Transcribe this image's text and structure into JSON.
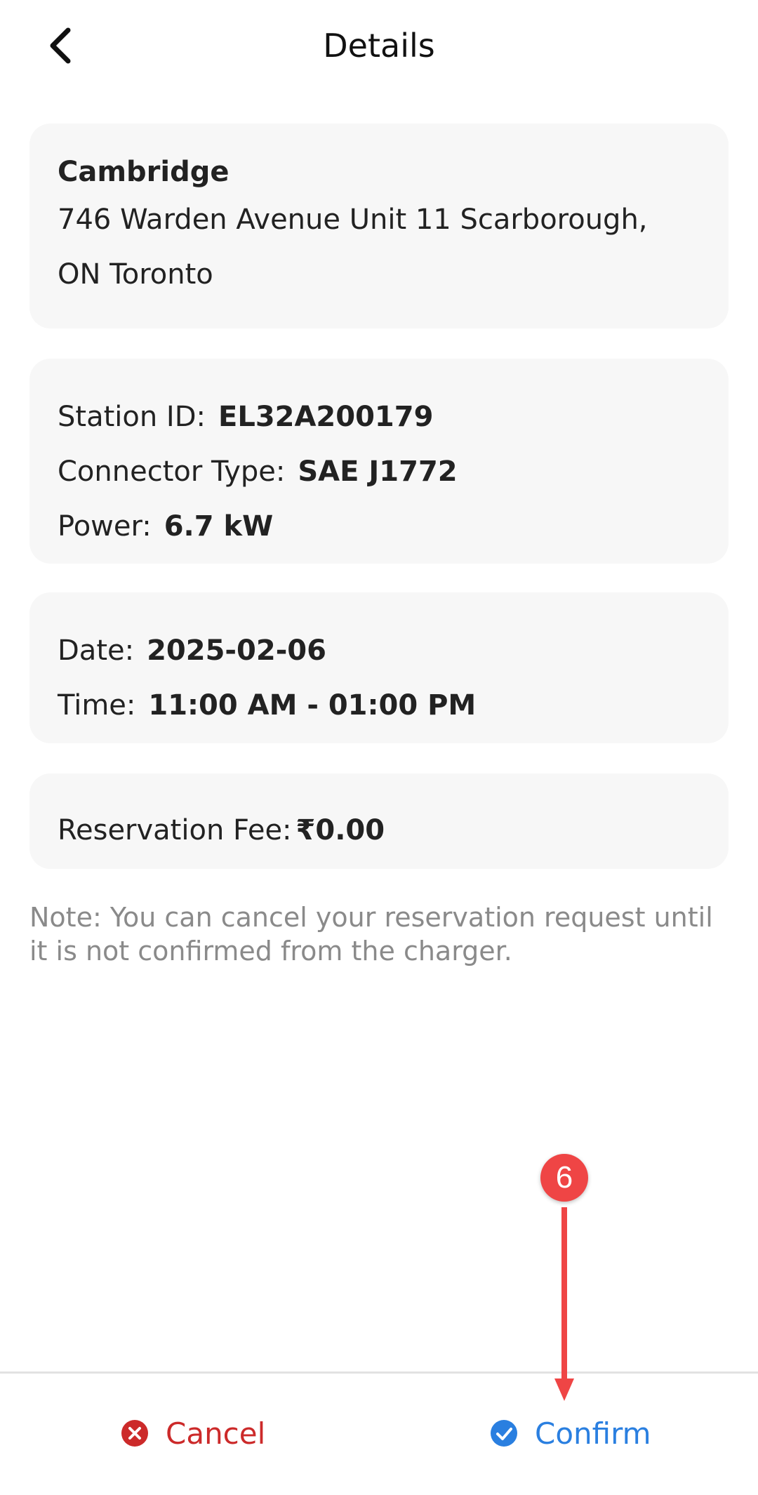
{
  "header": {
    "title": "Details",
    "back_icon": "chevron-left-icon"
  },
  "location": {
    "name": "Cambridge",
    "address": "746 Warden Avenue Unit 11 Scarborough, ON Toronto"
  },
  "station": {
    "id_label": "Station ID:",
    "id_value": "EL32A200179",
    "connector_label": "Connector Type:",
    "connector_value": "SAE J1772",
    "power_label": "Power:",
    "power_value": "6.7 kW"
  },
  "schedule": {
    "date_label": "Date:",
    "date_value": "2025-02-06",
    "time_label": "Time:",
    "time_value": "11:00 AM - 01:00 PM"
  },
  "fee": {
    "label": "Reservation Fee:",
    "value": "₹0.00"
  },
  "note": "Note: You can cancel your reservation request until it is not confirmed from the charger.",
  "actions": {
    "cancel_label": "Cancel",
    "confirm_label": "Confirm"
  },
  "annotation": {
    "step_number": "6"
  },
  "colors": {
    "cancel": "#cc2a2a",
    "confirm": "#2a7fe0",
    "card_bg": "#f7f7f7",
    "annotation": "#ef4545"
  }
}
